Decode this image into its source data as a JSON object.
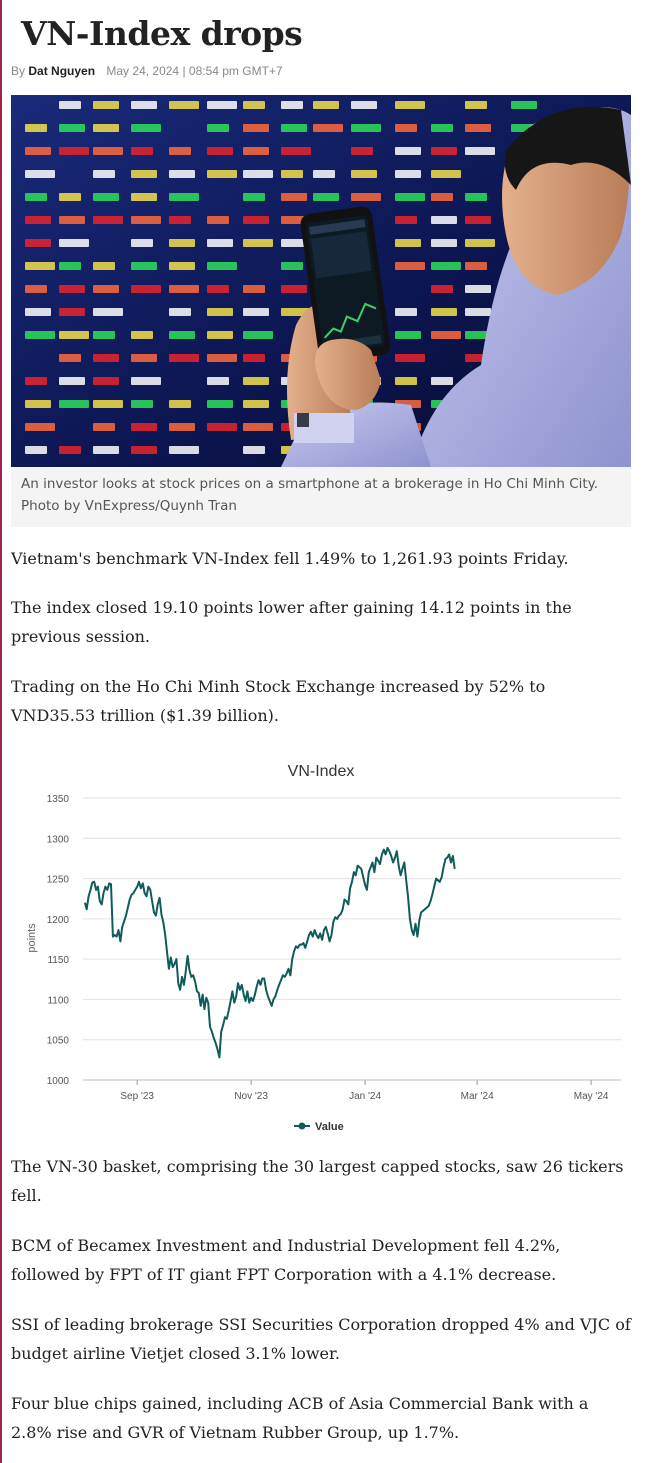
{
  "article": {
    "title": "VN-Index drops",
    "byline_prefix": "By",
    "author": "Dat Nguyen",
    "date": "May 24, 2024 | 08:54 pm GMT+7",
    "photo_caption": "An investor looks at stock prices on a smartphone at a brokerage in Ho Chi Minh City. Photo by VnExpress/Quynh Tran",
    "paragraphs": [
      "Vietnam's benchmark VN-Index fell 1.49% to 1,261.93 points Friday.",
      "The index closed 19.10 points lower after gaining 14.12 points in the previous session.",
      "Trading on the Ho Chi Minh Stock Exchange increased by 52% to VND35.53 trillion ($1.39 billion).",
      "The VN-30 basket, comprising the 30 largest capped stocks, saw 26 tickers fell.",
      "BCM of Becamex Investment and Industrial Development fell 4.2%, followed by FPT of IT giant FPT Corporation with a 4.1% decrease.",
      "SSI of leading brokerage SSI Securities Corporation dropped 4% and VJC of budget airline Vietjet closed 3.1% lower.",
      "Four blue chips gained, including ACB of Asia Commercial Bank with a 2.8% rise and GVR of Vietnam Rubber Group, up 1.7%."
    ]
  },
  "colors": {
    "brand": "#9f224e",
    "line": "#0f5c5a"
  },
  "chart_data": {
    "type": "line",
    "title": "VN-Index",
    "ylabel": "points",
    "xlabel": "",
    "ylim": [
      1000,
      1350
    ],
    "yticks": [
      1000,
      1050,
      1100,
      1150,
      1200,
      1250,
      1300,
      1350
    ],
    "xticks": [
      "Sep '23",
      "Nov '23",
      "Jan '24",
      "Mar '24",
      "May '24"
    ],
    "xtick_days": [
      6,
      67,
      128,
      188,
      249
    ],
    "x_range_days": [
      -23,
      265
    ],
    "grid": true,
    "legend": "bottom-center",
    "series": [
      {
        "name": "Value",
        "points": [
          [
            -22,
            1220
          ],
          [
            -21,
            1212
          ],
          [
            -20,
            1228
          ],
          [
            -19,
            1236
          ],
          [
            -18,
            1245
          ],
          [
            -17,
            1246
          ],
          [
            -16,
            1236
          ],
          [
            -15,
            1240
          ],
          [
            -14,
            1222
          ],
          [
            -13,
            1218
          ],
          [
            -12,
            1232
          ],
          [
            -11,
            1240
          ],
          [
            -10,
            1236
          ],
          [
            -9,
            1244
          ],
          [
            -8,
            1243
          ],
          [
            -7,
            1178
          ],
          [
            -6,
            1180
          ],
          [
            -5,
            1178
          ],
          [
            -4,
            1186
          ],
          [
            -3,
            1172
          ],
          [
            -2,
            1190
          ],
          [
            0,
            1204
          ],
          [
            2,
            1224
          ],
          [
            3,
            1230
          ],
          [
            4,
            1232
          ],
          [
            6,
            1240
          ],
          [
            7,
            1246
          ],
          [
            8,
            1238
          ],
          [
            9,
            1244
          ],
          [
            10,
            1232
          ],
          [
            11,
            1228
          ],
          [
            12,
            1240
          ],
          [
            13,
            1236
          ],
          [
            14,
            1222
          ],
          [
            15,
            1208
          ],
          [
            16,
            1204
          ],
          [
            17,
            1218
          ],
          [
            18,
            1226
          ],
          [
            19,
            1205
          ],
          [
            20,
            1196
          ],
          [
            21,
            1180
          ],
          [
            22,
            1158
          ],
          [
            23,
            1138
          ],
          [
            24,
            1152
          ],
          [
            25,
            1140
          ],
          [
            26,
            1144
          ],
          [
            27,
            1150
          ],
          [
            28,
            1120
          ],
          [
            29,
            1112
          ],
          [
            30,
            1128
          ],
          [
            31,
            1118
          ],
          [
            32,
            1134
          ],
          [
            33,
            1154
          ],
          [
            34,
            1136
          ],
          [
            35,
            1128
          ],
          [
            36,
            1130
          ],
          [
            37,
            1122
          ],
          [
            38,
            1110
          ],
          [
            39,
            1108
          ],
          [
            40,
            1092
          ],
          [
            41,
            1106
          ],
          [
            42,
            1088
          ],
          [
            43,
            1102
          ],
          [
            44,
            1096
          ],
          [
            45,
            1066
          ],
          [
            46,
            1060
          ],
          [
            47,
            1052
          ],
          [
            48,
            1046
          ],
          [
            49,
            1038
          ],
          [
            50,
            1028
          ],
          [
            51,
            1060
          ],
          [
            52,
            1068
          ],
          [
            53,
            1078
          ],
          [
            54,
            1076
          ],
          [
            55,
            1086
          ],
          [
            56,
            1098
          ],
          [
            57,
            1110
          ],
          [
            58,
            1096
          ],
          [
            59,
            1104
          ],
          [
            60,
            1120
          ],
          [
            61,
            1112
          ],
          [
            62,
            1118
          ],
          [
            63,
            1106
          ],
          [
            64,
            1098
          ],
          [
            65,
            1110
          ],
          [
            66,
            1096
          ],
          [
            67,
            1102
          ],
          [
            68,
            1098
          ],
          [
            69,
            1106
          ],
          [
            70,
            1116
          ],
          [
            71,
            1124
          ],
          [
            72,
            1118
          ],
          [
            73,
            1126
          ],
          [
            74,
            1126
          ],
          [
            75,
            1112
          ],
          [
            76,
            1104
          ],
          [
            77,
            1098
          ],
          [
            78,
            1092
          ],
          [
            79,
            1100
          ],
          [
            80,
            1104
          ],
          [
            81,
            1112
          ],
          [
            82,
            1118
          ],
          [
            83,
            1124
          ],
          [
            84,
            1130
          ],
          [
            85,
            1128
          ],
          [
            86,
            1132
          ],
          [
            87,
            1138
          ],
          [
            88,
            1130
          ],
          [
            89,
            1150
          ],
          [
            90,
            1160
          ],
          [
            91,
            1166
          ],
          [
            92,
            1164
          ],
          [
            93,
            1168
          ],
          [
            94,
            1168
          ],
          [
            95,
            1170
          ],
          [
            96,
            1164
          ],
          [
            97,
            1172
          ],
          [
            98,
            1180
          ],
          [
            99,
            1184
          ],
          [
            100,
            1178
          ],
          [
            101,
            1186
          ],
          [
            102,
            1180
          ],
          [
            103,
            1176
          ],
          [
            104,
            1182
          ],
          [
            105,
            1174
          ],
          [
            106,
            1186
          ],
          [
            107,
            1190
          ],
          [
            108,
            1182
          ],
          [
            109,
            1172
          ],
          [
            110,
            1180
          ],
          [
            111,
            1196
          ],
          [
            112,
            1202
          ],
          [
            113,
            1200
          ],
          [
            114,
            1204
          ],
          [
            115,
            1206
          ],
          [
            116,
            1212
          ],
          [
            117,
            1224
          ],
          [
            118,
            1222
          ],
          [
            119,
            1218
          ],
          [
            120,
            1238
          ],
          [
            121,
            1246
          ],
          [
            122,
            1258
          ],
          [
            123,
            1254
          ],
          [
            124,
            1266
          ],
          [
            125,
            1264
          ],
          [
            126,
            1262
          ],
          [
            127,
            1252
          ],
          [
            128,
            1242
          ],
          [
            129,
            1236
          ],
          [
            130,
            1258
          ],
          [
            131,
            1264
          ],
          [
            132,
            1270
          ],
          [
            133,
            1258
          ],
          [
            134,
            1276
          ],
          [
            135,
            1272
          ],
          [
            136,
            1268
          ],
          [
            137,
            1280
          ],
          [
            138,
            1286
          ],
          [
            139,
            1280
          ],
          [
            140,
            1288
          ],
          [
            141,
            1284
          ],
          [
            142,
            1278
          ],
          [
            143,
            1270
          ],
          [
            144,
            1276
          ],
          [
            145,
            1284
          ],
          [
            146,
            1266
          ],
          [
            147,
            1254
          ],
          [
            148,
            1262
          ],
          [
            149,
            1270
          ],
          [
            150,
            1248
          ],
          [
            151,
            1228
          ],
          [
            152,
            1200
          ],
          [
            153,
            1186
          ],
          [
            154,
            1180
          ],
          [
            155,
            1194
          ],
          [
            156,
            1178
          ],
          [
            157,
            1198
          ],
          [
            158,
            1208
          ],
          [
            159,
            1210
          ],
          [
            160,
            1212
          ],
          [
            161,
            1214
          ],
          [
            162,
            1216
          ],
          [
            163,
            1222
          ],
          [
            164,
            1230
          ],
          [
            165,
            1240
          ],
          [
            166,
            1250
          ],
          [
            167,
            1248
          ],
          [
            168,
            1246
          ],
          [
            169,
            1252
          ],
          [
            170,
            1264
          ],
          [
            171,
            1274
          ],
          [
            172,
            1276
          ],
          [
            173,
            1280
          ],
          [
            174,
            1270
          ],
          [
            175,
            1278
          ],
          [
            176,
            1262
          ]
        ]
      }
    ]
  }
}
